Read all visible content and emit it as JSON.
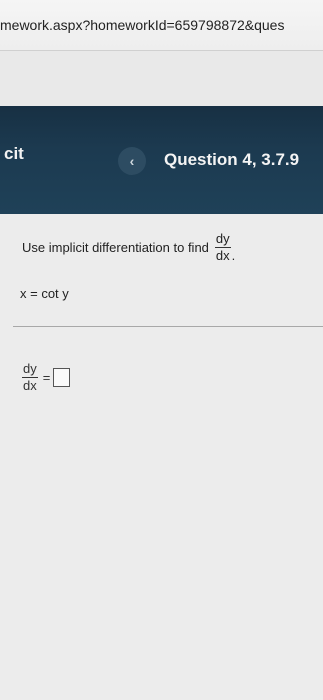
{
  "browser": {
    "url_text": "mework.aspx?homeworkId=659798872&ques"
  },
  "header": {
    "section_title": "cit",
    "prev_icon": "chevron-left-icon",
    "prev_glyph": "‹",
    "question_title": "Question 4, 3.7.9"
  },
  "problem": {
    "instruction": "Use implicit differentiation to find",
    "fraction_numerator": "dy",
    "fraction_denominator": "dx",
    "period": ".",
    "equation": "x = cot y"
  },
  "answer": {
    "fraction_numerator": "dy",
    "fraction_denominator": "dx",
    "equals": "=",
    "value": ""
  }
}
